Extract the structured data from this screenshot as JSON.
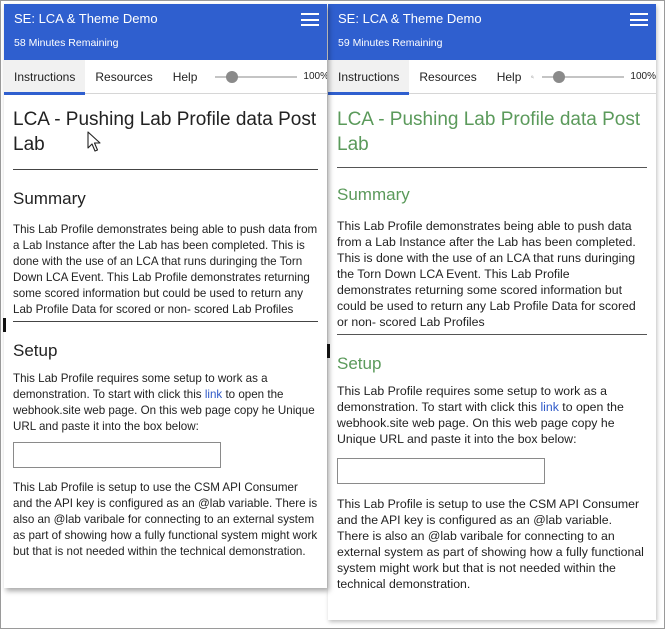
{
  "panels": [
    {
      "app_title": "SE: LCA & Theme Demo",
      "timer": "58 Minutes Remaining",
      "tabs": [
        "Instructions",
        "Resources",
        "Help"
      ],
      "zoom": "100%",
      "zoom_level": 0.15,
      "doc_title": "LCA - Pushing Lab Profile data Post Lab",
      "summary_heading": "Summary",
      "summary_text": "This Lab Profile demonstrates being able to push data from a Lab Instance after the Lab has been completed. This is done with the use of an LCA that runs duringing the Torn Down LCA Event. This Lab Profile demonstrates returning some scored information but could be used to return any Lab Profile Data for scored or non- scored Lab Profiles",
      "setup_heading": "Setup",
      "setup_text_before": "This Lab Profile requires some setup to work as a demonstration. To start with click this ",
      "setup_link": "link",
      "setup_text_after": " to open the webhook.site web page. On this web page copy he Unique URL and paste it into the box below:",
      "url_input_value": "",
      "csm_text": "This Lab Profile is setup to use the CSM API Consumer and the API key is configured as an @lab variable. There is also an @lab varibale for connecting to an external system as part of showing how a fully functional system might work but that is not needed within the technical demonstration."
    },
    {
      "app_title": "SE: LCA & Theme Demo",
      "timer": "59 Minutes Remaining",
      "tabs": [
        "Instructions",
        "Resources",
        "Help"
      ],
      "zoom": "100%",
      "zoom_level": 0.15,
      "doc_title": "LCA - Pushing Lab Profile data Post Lab",
      "summary_heading": "Summary",
      "summary_text": "This Lab Profile demonstrates being able to push data from a Lab Instance after the Lab has been completed. This is done with the use of an LCA that runs duringing the Torn Down LCA Event. This Lab Profile demonstrates returning some scored information but could be used to return any Lab Profile Data for scored or non- scored Lab Profiles",
      "setup_heading": "Setup",
      "setup_text_before": "This Lab Profile requires some setup to work as a demonstration. To start with click this ",
      "setup_link": "link",
      "setup_text_after": " to open the webhook.site web page. On this web page copy he Unique URL and paste it into the box below:",
      "url_input_value": "",
      "csm_text": "This Lab Profile is setup to use the CSM API Consumer and the API key is configured as an @lab variable. There is also an @lab varibale for connecting to an external system as part of showing how a fully functional system might work but that is not needed within the technical demonstration."
    }
  ],
  "icons": {
    "menu": "hamburger-menu-icon",
    "zoom": "magnifier-icon",
    "cursor": "mouse-pointer-icon"
  },
  "colors": {
    "header_bg": "#2f5fcf",
    "active_tab_underline": "#2f5fcf",
    "link": "#2e59c8",
    "themed_heading": "#5b9a5b"
  }
}
